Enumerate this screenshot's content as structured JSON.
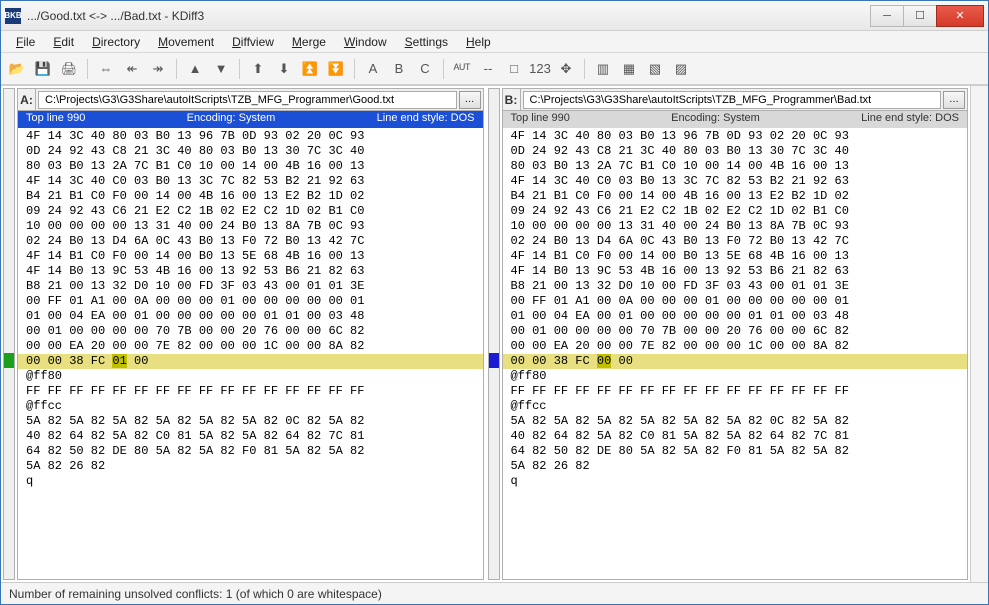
{
  "window": {
    "title": ".../Good.txt <-> .../Bad.txt - KDiff3",
    "app_icon_text": "BKB"
  },
  "menu": [
    "File",
    "Edit",
    "Directory",
    "Movement",
    "Diffview",
    "Merge",
    "Window",
    "Settings",
    "Help"
  ],
  "toolbar_icons": [
    "open",
    "save",
    "print",
    "|",
    "goto-current",
    "prev-diff",
    "next-diff",
    "|",
    "prev-conflict",
    "next-conflict",
    "|",
    "up-delta",
    "down-delta",
    "up-double",
    "down-double",
    "|",
    "choose-a",
    "choose-b",
    "choose-c",
    "|",
    "auto",
    "split",
    "square",
    "123",
    "join",
    "|",
    "align1",
    "align2",
    "align3",
    "align4"
  ],
  "panes": {
    "A": {
      "label": "A:",
      "path": "C:\\Projects\\G3\\G3Share\\autoItScripts\\TZB_MFG_Programmer\\Good.txt",
      "top_line": "Top line 990",
      "encoding": "Encoding: System",
      "line_end": "Line end style: DOS",
      "active": true,
      "lines": [
        "4F 14 3C 40 80 03 B0 13 96 7B 0D 93 02 20 0C 93",
        "0D 24 92 43 C8 21 3C 40 80 03 B0 13 30 7C 3C 40",
        "80 03 B0 13 2A 7C B1 C0 10 00 14 00 4B 16 00 13",
        "4F 14 3C 40 C0 03 B0 13 3C 7C 82 53 B2 21 92 63",
        "B4 21 B1 C0 F0 00 14 00 4B 16 00 13 E2 B2 1D 02",
        "09 24 92 43 C6 21 E2 C2 1B 02 E2 C2 1D 02 B1 C0",
        "10 00 00 00 00 13 31 40 00 24 B0 13 8A 7B 0C 93",
        "02 24 B0 13 D4 6A 0C 43 B0 13 F0 72 B0 13 42 7C",
        "4F 14 B1 C0 F0 00 14 00 B0 13 5E 68 4B 16 00 13",
        "4F 14 B0 13 9C 53 4B 16 00 13 92 53 B6 21 82 63",
        "B8 21 00 13 32 D0 10 00 FD 3F 03 43 00 01 01 3E",
        "00 FF 01 A1 00 0A 00 00 00 01 00 00 00 00 00 01",
        "01 00 04 EA 00 01 00 00 00 00 00 01 01 00 03 48",
        "00 01 00 00 00 00 70 7B 00 00 20 76 00 00 6C 82",
        "00 00 EA 20 00 00 7E 82 00 00 00 1C 00 00 8A 82",
        {
          "text_before": "00 00 38 FC ",
          "diff": "01",
          "text_after": " 00",
          "highlight": true
        },
        "@ff80",
        "FF FF FF FF FF FF FF FF FF FF FF FF FF FF FF FF",
        "@ffcc",
        "5A 82 5A 82 5A 82 5A 82 5A 82 5A 82 0C 82 5A 82",
        "40 82 64 82 5A 82 C0 81 5A 82 5A 82 64 82 7C 81",
        "64 82 50 82 DE 80 5A 82 5A 82 F0 81 5A 82 5A 82",
        "5A 82 26 82",
        "q"
      ]
    },
    "B": {
      "label": "B:",
      "path": "C:\\Projects\\G3\\G3Share\\autoItScripts\\TZB_MFG_Programmer\\Bad.txt",
      "top_line": "Top line 990",
      "encoding": "Encoding: System",
      "line_end": "Line end style: DOS",
      "active": false,
      "lines": [
        "4F 14 3C 40 80 03 B0 13 96 7B 0D 93 02 20 0C 93",
        "0D 24 92 43 C8 21 3C 40 80 03 B0 13 30 7C 3C 40",
        "80 03 B0 13 2A 7C B1 C0 10 00 14 00 4B 16 00 13",
        "4F 14 3C 40 C0 03 B0 13 3C 7C 82 53 B2 21 92 63",
        "B4 21 B1 C0 F0 00 14 00 4B 16 00 13 E2 B2 1D 02",
        "09 24 92 43 C6 21 E2 C2 1B 02 E2 C2 1D 02 B1 C0",
        "10 00 00 00 00 13 31 40 00 24 B0 13 8A 7B 0C 93",
        "02 24 B0 13 D4 6A 0C 43 B0 13 F0 72 B0 13 42 7C",
        "4F 14 B1 C0 F0 00 14 00 B0 13 5E 68 4B 16 00 13",
        "4F 14 B0 13 9C 53 4B 16 00 13 92 53 B6 21 82 63",
        "B8 21 00 13 32 D0 10 00 FD 3F 03 43 00 01 01 3E",
        "00 FF 01 A1 00 0A 00 00 00 01 00 00 00 00 00 01",
        "01 00 04 EA 00 01 00 00 00 00 00 01 01 00 03 48",
        "00 01 00 00 00 00 70 7B 00 00 20 76 00 00 6C 82",
        "00 00 EA 20 00 00 7E 82 00 00 00 1C 00 00 8A 82",
        {
          "text_before": "00 00 38 FC ",
          "diff": "00",
          "text_after": " 00",
          "highlight": true
        },
        "@ff80",
        "FF FF FF FF FF FF FF FF FF FF FF FF FF FF FF FF",
        "@ffcc",
        "5A 82 5A 82 5A 82 5A 82 5A 82 5A 82 0C 82 5A 82",
        "40 82 64 82 5A 82 C0 81 5A 82 5A 82 64 82 7C 81",
        "64 82 50 82 DE 80 5A 82 5A 82 F0 81 5A 82 5A 82",
        "5A 82 26 82",
        "q"
      ]
    }
  },
  "gutters": {
    "left_color": "#1aa01a",
    "right_color": "#1a1ad6",
    "highlight_row_index": 15
  },
  "status": "Number of remaining unsolved conflicts: 1 (of which 0 are whitespace)"
}
